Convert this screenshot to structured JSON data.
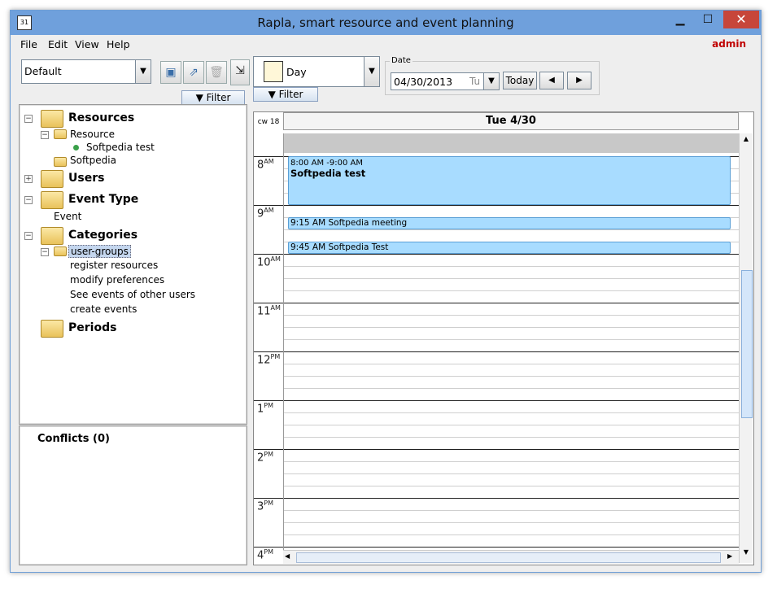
{
  "window": {
    "title": "Rapla, smart resource and event planning",
    "minimize": "▁",
    "maximize": "☐",
    "close": "✕",
    "app_icon": "31"
  },
  "menu": {
    "items": [
      "File",
      "Edit",
      "View",
      "Help"
    ],
    "user": "admin"
  },
  "left": {
    "view_combo": "Default",
    "toolbar_icons": [
      "save-icon",
      "export-icon",
      "delete-icon",
      "detach-icon"
    ],
    "filter_label": "Filter",
    "tree": {
      "resources": "Resources",
      "resource_type": "Resource",
      "resource_item": "Softpedia test",
      "softpedia": "Softpedia",
      "users": "Users",
      "event_type": "Event Type",
      "event": "Event",
      "categories": "Categories",
      "user_groups": "user-groups",
      "groups": [
        "register resources",
        "modify preferences",
        "See events of other users",
        "create events"
      ],
      "periods": "Periods"
    },
    "conflicts": "Conflicts (0)"
  },
  "right": {
    "view_combo": "Day",
    "date_label": "Date",
    "date_value": "04/30/2013",
    "date_day": "Tu",
    "today": "Today",
    "prev": "◀",
    "next": "▶",
    "filter_label": "Filter",
    "week": "cw 18",
    "day_header": "Tue 4/30",
    "hours": [
      {
        "h": "8",
        "ap": "AM"
      },
      {
        "h": "9",
        "ap": "AM"
      },
      {
        "h": "10",
        "ap": "AM"
      },
      {
        "h": "11",
        "ap": "AM"
      },
      {
        "h": "12",
        "ap": "PM"
      },
      {
        "h": "1",
        "ap": "PM"
      },
      {
        "h": "2",
        "ap": "PM"
      },
      {
        "h": "3",
        "ap": "PM"
      },
      {
        "h": "4",
        "ap": "PM"
      }
    ],
    "events": [
      {
        "time": "8:00 AM -9:00 AM",
        "title": "Softpedia test"
      },
      {
        "time": "9:15 AM",
        "title": "Softpedia meeting"
      },
      {
        "time": "9:45 AM",
        "title": "Softpedia Test"
      }
    ]
  }
}
